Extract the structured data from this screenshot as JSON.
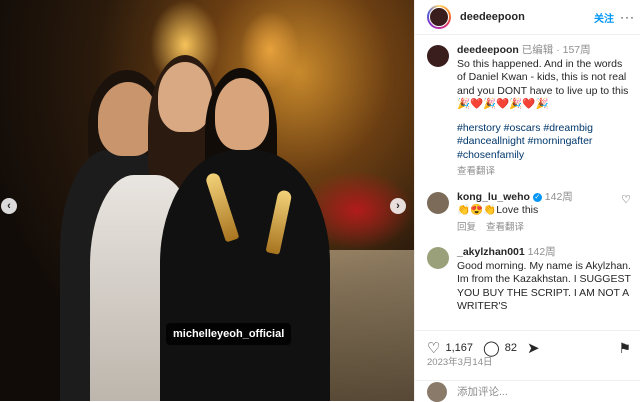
{
  "photo": {
    "tag_label": "michelleyeoh_official",
    "nav_prev": "‹",
    "nav_next": "›"
  },
  "header": {
    "username": "deedeepoon",
    "follow_label": "关注",
    "more_icon": "···"
  },
  "caption": {
    "username": "deedeepoon",
    "edited": "已编辑",
    "age": "157周",
    "text": "So this happened.  And in the words of Daniel Kwan - kids, this is not real and you DONT have to live up to this 🎉❤️🎉❤️🎉❤️🎉",
    "hashtags": "#herstory #oscars #dreambig #danceallnight #morningafter #chosenfamily",
    "translate": "查看翻译"
  },
  "comments": [
    {
      "username": "kong_lu_weho",
      "verified": true,
      "age": "142周",
      "text": "👏😍👏Love this",
      "reply": "回复",
      "translate": "查看翻译"
    },
    {
      "username": "_akylzhan001",
      "age": "142周",
      "text": "Good morning. My name is Akylzhan. Im from the Kazakhstan. I SUGGEST YOU BUY THE SCRIPT. I AM NOT A WRITER'S"
    }
  ],
  "actions": {
    "like_count": "1,167",
    "comment_count": "82"
  },
  "post_date": "2023年3月14日",
  "add_comment_placeholder": "添加评论..."
}
